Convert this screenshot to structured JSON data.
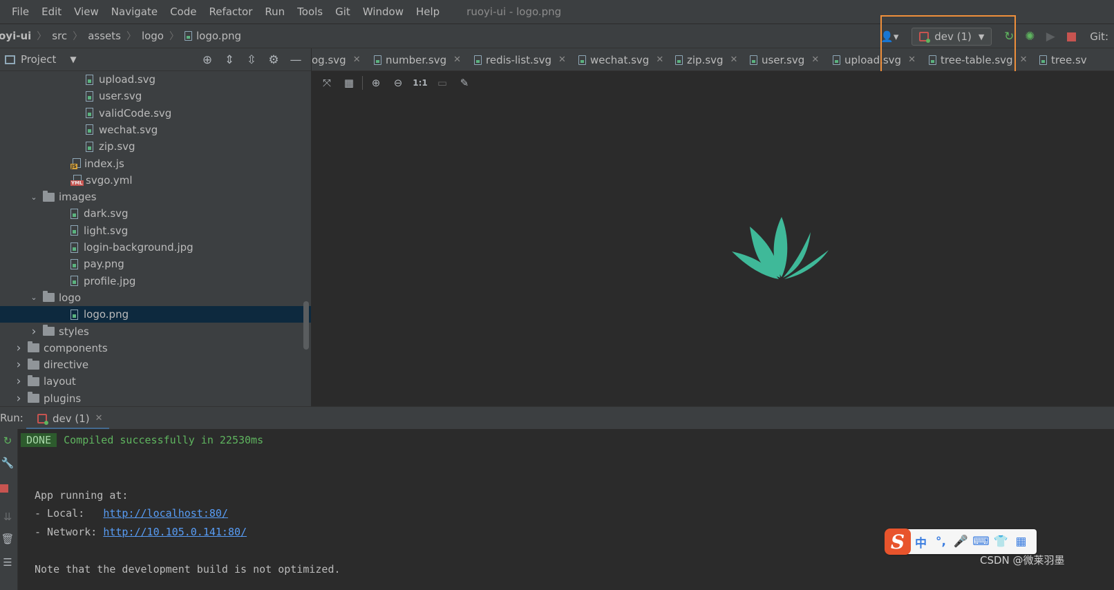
{
  "menu": {
    "items": [
      "File",
      "Edit",
      "View",
      "Navigate",
      "Code",
      "Refactor",
      "Run",
      "Tools",
      "Git",
      "Window",
      "Help"
    ],
    "window_title": "ruoyi-ui - logo.png"
  },
  "breadcrumb": {
    "items": [
      "oyi-ui",
      "src",
      "assets",
      "logo",
      "logo.png"
    ]
  },
  "toolbar": {
    "run_config": "dev (1)",
    "git_label": "Git:"
  },
  "project": {
    "title": "Project",
    "tree": [
      {
        "label": "upload.svg",
        "type": "svg",
        "depth": 6
      },
      {
        "label": "user.svg",
        "type": "svg",
        "depth": 6
      },
      {
        "label": "validCode.svg",
        "type": "svg",
        "depth": 6
      },
      {
        "label": "wechat.svg",
        "type": "svg",
        "depth": 6
      },
      {
        "label": "zip.svg",
        "type": "svg",
        "depth": 6
      },
      {
        "label": "index.js",
        "type": "js",
        "depth": 5
      },
      {
        "label": "svgo.yml",
        "type": "yml",
        "depth": 5
      },
      {
        "label": "images",
        "type": "folder-open",
        "depth": 3
      },
      {
        "label": "dark.svg",
        "type": "svg",
        "depth": 5
      },
      {
        "label": "light.svg",
        "type": "svg",
        "depth": 5
      },
      {
        "label": "login-background.jpg",
        "type": "svg",
        "depth": 5
      },
      {
        "label": "pay.png",
        "type": "svg",
        "depth": 5
      },
      {
        "label": "profile.jpg",
        "type": "svg",
        "depth": 5
      },
      {
        "label": "logo",
        "type": "folder-open",
        "depth": 3
      },
      {
        "label": "logo.png",
        "type": "svg",
        "depth": 5,
        "selected": true
      },
      {
        "label": "styles",
        "type": "folder-closed",
        "depth": 3
      },
      {
        "label": "components",
        "type": "folder-closed",
        "depth": 2
      },
      {
        "label": "directive",
        "type": "folder-closed",
        "depth": 2
      },
      {
        "label": "layout",
        "type": "folder-closed",
        "depth": 2
      },
      {
        "label": "plugins",
        "type": "folder-closed",
        "depth": 2
      }
    ]
  },
  "tabs": [
    "og.svg",
    "number.svg",
    "redis-list.svg",
    "wechat.svg",
    "zip.svg",
    "user.svg",
    "upload.svg",
    "tree-table.svg",
    "tree.sv"
  ],
  "viewer": {
    "actual_size_label": "1:1",
    "logo_color": "#3fb999"
  },
  "run": {
    "label": "Run:",
    "tab": "dev (1)",
    "done": "DONE",
    "compiled": "Compiled successfully in 22530ms",
    "app_running": "App running at:",
    "local_label": "- Local:   ",
    "local_url": "http://localhost:80/",
    "network_label": "- Network: ",
    "network_url": "http://10.105.0.141:80/",
    "note": "Note that the development build is not optimized."
  },
  "ime": {
    "logo": "S",
    "items": [
      "中",
      "°,",
      "🎤",
      "⌨",
      "👕",
      "▦"
    ]
  },
  "watermark": "CSDN @微莱羽墨",
  "colors": {
    "accent_highlight": "#f0903b",
    "selection": "#0d293e",
    "success": "#5fb55f",
    "link": "#589df6"
  }
}
